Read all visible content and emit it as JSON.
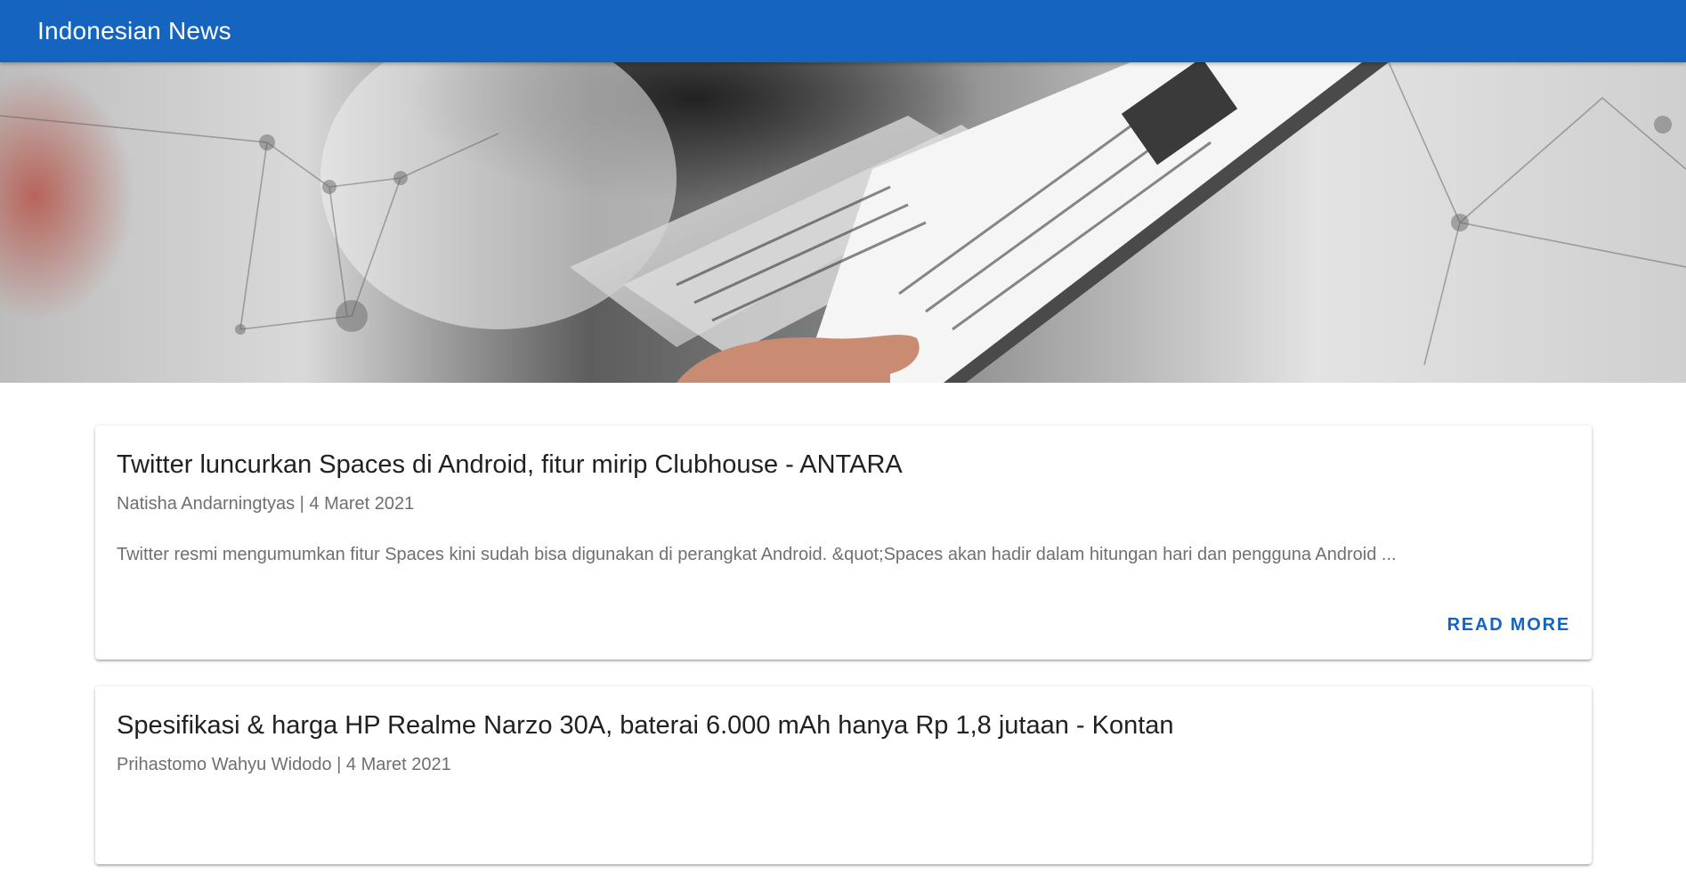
{
  "app_bar": {
    "title": "Indonesian News",
    "color": "#1565c0"
  },
  "hero": {
    "image": "newspaper-reading-photo-banner"
  },
  "articles": [
    {
      "title": "Twitter luncurkan Spaces di Android, fitur mirip Clubhouse - ANTARA",
      "meta": "Natisha Andarningtyas | 4 Maret 2021",
      "description": "Twitter resmi mengumumkan fitur Spaces kini sudah bisa digunakan di perangkat Android. &quot;Spaces akan hadir dalam hitungan hari dan pengguna Android ...",
      "action": "READ MORE"
    },
    {
      "title": "Spesifikasi & harga HP Realme Narzo 30A, baterai 6.000 mAh hanya Rp 1,8 jutaan - Kontan",
      "meta": "Prihastomo Wahyu Widodo | 4 Maret 2021"
    }
  ]
}
